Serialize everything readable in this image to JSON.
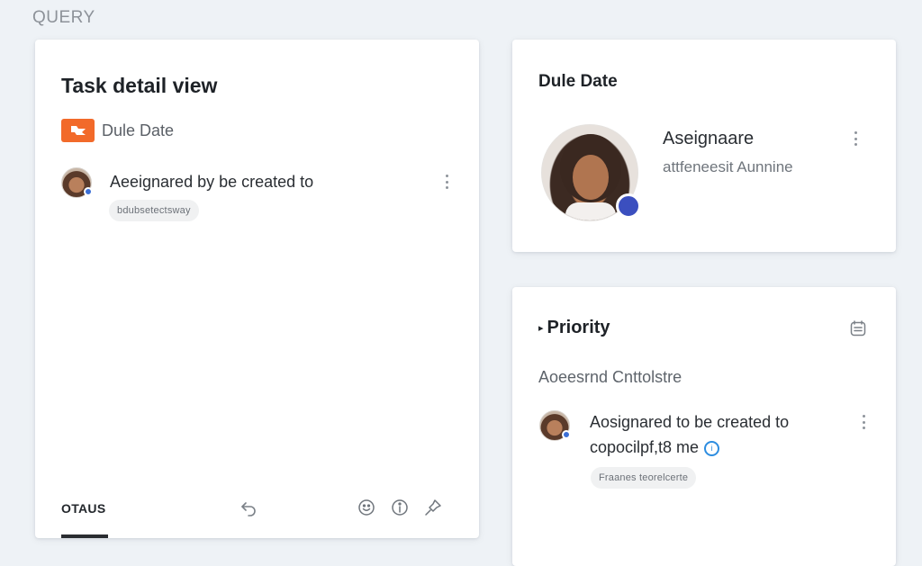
{
  "page": {
    "query_label": "QUERY"
  },
  "task_card": {
    "title": "Task detail view",
    "due_label": "Dule Date",
    "activity": {
      "text": "Aeeignared by be created to",
      "chip": "bdubsetectsway"
    },
    "footer": {
      "tab_label": "OTAUS",
      "icons": [
        "undo-icon",
        "emoji-icon",
        "info-icon",
        "pin-icon"
      ]
    }
  },
  "due_card": {
    "title": "Dule Date",
    "assignee_name": "Aseignaare",
    "assignee_sub": "attfeneesit Aunnine"
  },
  "priority_card": {
    "title": "Priority",
    "subtitle": "Aoeesrnd Cnttolstre",
    "activity": {
      "line1": "Aosignared to be created to",
      "line2": "copocilpf,t8 me",
      "chip": "Fraanes teorelcerte"
    }
  },
  "colors": {
    "accent_orange": "#f26a2a",
    "status_blue": "#3b4fbf",
    "info_blue": "#2d8de0"
  }
}
